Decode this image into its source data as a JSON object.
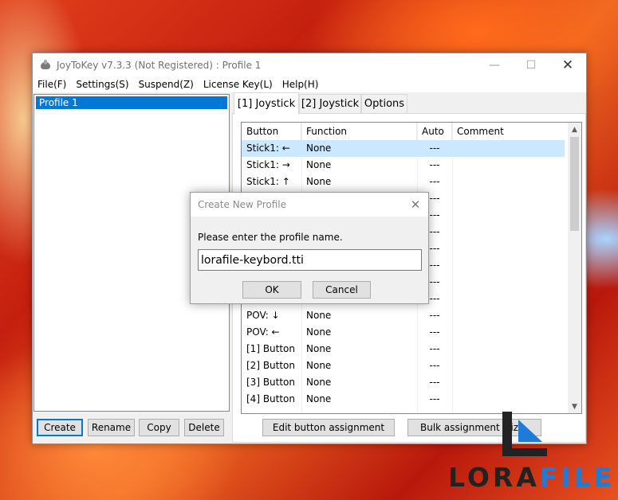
{
  "window": {
    "title": "JoyToKey v7.3.3 (Not Registered) : Profile 1",
    "minimize": "—",
    "maximize": "☐",
    "close": "✕"
  },
  "menu": [
    "File(F)",
    "Settings(S)",
    "Suspend(Z)",
    "License Key(L)",
    "Help(H)"
  ],
  "profiles": [
    "Profile 1"
  ],
  "profile_buttons": {
    "create": "Create",
    "rename": "Rename",
    "copy": "Copy",
    "delete": "Delete"
  },
  "tabs": [
    "[1] Joystick",
    "[2] Joystick",
    "Options"
  ],
  "table": {
    "headers": [
      "Button",
      "Function",
      "Auto",
      "Comment"
    ],
    "rows": [
      [
        "Stick1: ←",
        "None",
        "---",
        ""
      ],
      [
        "Stick1: →",
        "None",
        "---",
        ""
      ],
      [
        "Stick1: ↑",
        "None",
        "---",
        ""
      ],
      [
        "",
        "",
        "---",
        ""
      ],
      [
        "",
        "",
        "---",
        ""
      ],
      [
        "",
        "",
        "---",
        ""
      ],
      [
        "",
        "",
        "---",
        ""
      ],
      [
        "",
        "",
        "---",
        ""
      ],
      [
        "",
        "",
        "---",
        ""
      ],
      [
        "",
        "",
        "---",
        ""
      ],
      [
        "POV: ↓",
        "None",
        "---",
        ""
      ],
      [
        "POV: ←",
        "None",
        "---",
        ""
      ],
      [
        "[1] Button",
        "None",
        "---",
        ""
      ],
      [
        "[2] Button",
        "None",
        "---",
        ""
      ],
      [
        "[3] Button",
        "None",
        "---",
        ""
      ],
      [
        "[4] Button",
        "None",
        "---",
        ""
      ]
    ],
    "selected_row": 0
  },
  "panel_buttons": {
    "edit": "Edit button assignment",
    "bulk": "Bulk assignment wiza"
  },
  "dialog": {
    "title": "Create New Profile",
    "close": "✕",
    "prompt": "Please enter the profile name.",
    "input_value": "lorafile-keybord.tti",
    "ok": "OK",
    "cancel": "Cancel"
  },
  "watermark": {
    "part1": "LORA",
    "part2": "FILE"
  },
  "colors": {
    "selection": "#0078d7",
    "row_selected": "#cce8ff",
    "logo_blue": "#1f7bd8",
    "logo_dark": "#222222"
  }
}
